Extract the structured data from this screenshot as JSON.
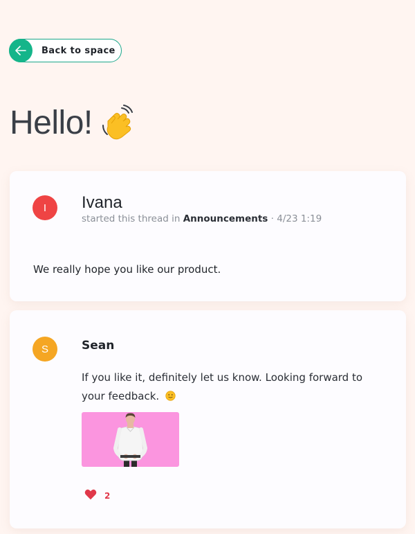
{
  "back_button": {
    "label": "Back to space"
  },
  "page": {
    "title": "Hello!",
    "title_emoji": "waving-hand"
  },
  "thread": {
    "author": "Ivana",
    "avatar_initial": "I",
    "avatar_color": "#ef4444",
    "meta_prefix": "started this thread in",
    "space": "Announcements",
    "meta_separator": "·",
    "timestamp": "4/23 1:19",
    "body": "We really hope you like our product."
  },
  "reply": {
    "author": "Sean",
    "avatar_initial": "S",
    "avatar_color": "#f5a623",
    "text": "If you like it, definitely let us know. Looking forward to your feedback.",
    "emoji": "slightly-smiling-face",
    "gif": {
      "background": "#fb95df",
      "subject": "man-in-white-shirt"
    },
    "reaction": {
      "icon": "heart-icon",
      "count": "2",
      "color": "#e0384a"
    }
  },
  "colors": {
    "background": "#fff5f1",
    "accent": "#15b58a",
    "card": "#fdfcff"
  }
}
